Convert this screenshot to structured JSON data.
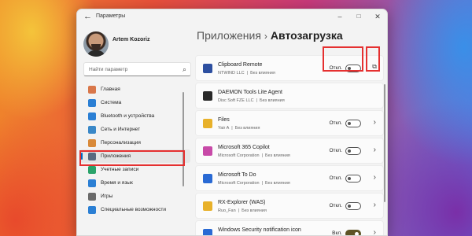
{
  "window": {
    "title": "Параметры",
    "back_icon": "back-arrow-icon",
    "controls": {
      "minimize": "–",
      "maximize": "□",
      "close": "✕"
    }
  },
  "profile": {
    "name": "Artem Kozoriz"
  },
  "search": {
    "placeholder": "Найти параметр",
    "icon": "search-icon"
  },
  "sidebar": {
    "items": [
      {
        "label": "Главная",
        "icon": "home-icon",
        "color": "#d9774a"
      },
      {
        "label": "Система",
        "icon": "system-icon",
        "color": "#2b7fd4"
      },
      {
        "label": "Bluetooth и устройства",
        "icon": "bluetooth-icon",
        "color": "#2b7fd4"
      },
      {
        "label": "Сеть и Интернет",
        "icon": "network-icon",
        "color": "#3a88c8"
      },
      {
        "label": "Персонализация",
        "icon": "brush-icon",
        "color": "#d98a3a"
      },
      {
        "label": "Приложения",
        "icon": "apps-icon",
        "color": "#5a6a80",
        "active": true
      },
      {
        "label": "Учетные записи",
        "icon": "accounts-icon",
        "color": "#2aa36a"
      },
      {
        "label": "Время и язык",
        "icon": "globe-icon",
        "color": "#2b7fd4"
      },
      {
        "label": "Игры",
        "icon": "gamepad-icon",
        "color": "#6a6a6a"
      },
      {
        "label": "Специальные возможности",
        "icon": "accessibility-icon",
        "color": "#2b7fd4"
      }
    ]
  },
  "breadcrumb": {
    "parent": "Приложения",
    "separator": "›",
    "current": "Автозагрузка"
  },
  "startup_apps": [
    {
      "name": "Clipboard Remote",
      "publisher": "NTWIND LLC",
      "impact": "Без влияния",
      "state": "Откл.",
      "on": false,
      "trailing": "external",
      "icon_color": "#2d4fa0"
    },
    {
      "name": "DAEMON Tools Lite Agent",
      "publisher": "Disc Soft FZE LLC",
      "impact": "Без влияния",
      "state": "",
      "on": null,
      "trailing": "",
      "icon_color": "#2a2a2a"
    },
    {
      "name": "Files",
      "publisher": "Yair A",
      "impact": "Без влияния",
      "state": "Откл.",
      "on": false,
      "trailing": "chevron",
      "icon_color": "#e8b12a"
    },
    {
      "name": "Microsoft 365 Copilot",
      "publisher": "Microsoft Corporation",
      "impact": "Без влияния",
      "state": "Откл.",
      "on": false,
      "trailing": "chevron",
      "icon_color": "#c84aa8"
    },
    {
      "name": "Microsoft To Do",
      "publisher": "Microsoft Corporation",
      "impact": "Без влияния",
      "state": "Откл.",
      "on": false,
      "trailing": "chevron",
      "icon_color": "#2a6ad4"
    },
    {
      "name": "RX-Explorer (WAS)",
      "publisher": "Ruo_Fan",
      "impact": "Без влияния",
      "state": "Откл.",
      "on": false,
      "trailing": "chevron",
      "icon_color": "#e8b12a"
    },
    {
      "name": "Windows Security notification icon",
      "publisher": "Microsoft Corporation",
      "impact": "Не измерено",
      "state": "Вкл.",
      "on": true,
      "trailing": "chevron",
      "icon_color": "#2a6ad4"
    }
  ]
}
